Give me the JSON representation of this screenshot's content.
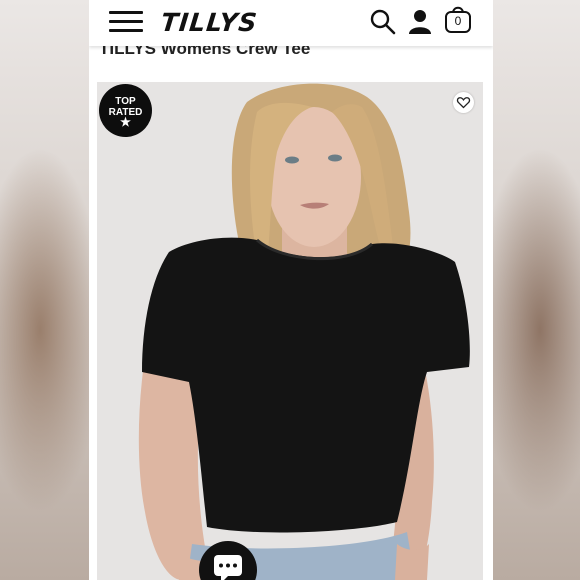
{
  "header": {
    "brand": "TILLYS",
    "menu_icon": "hamburger-menu-icon",
    "search_icon": "search-icon",
    "account_icon": "user-icon",
    "cart_icon": "shopping-bag-icon",
    "cart_count": "0"
  },
  "product": {
    "title": "TILLYS Womens Crew Tee",
    "badge_line1": "TOP",
    "badge_line2": "RATED",
    "badge_star": "★",
    "favorite_icon": "heart-icon",
    "image_icon": "product-photo"
  },
  "chat": {
    "icon": "chat-bubble-icon"
  },
  "colors": {
    "brand_black": "#111111",
    "page_bg": "#ffffff",
    "photo_bg": "#e6e4e3"
  }
}
